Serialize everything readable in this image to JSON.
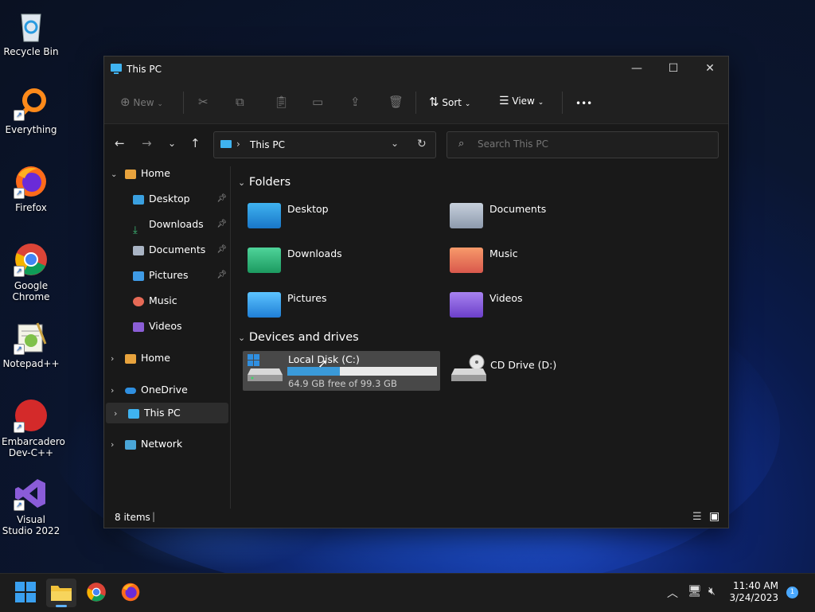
{
  "desktop": {
    "icons": [
      {
        "label": "Recycle Bin"
      },
      {
        "label": "Everything"
      },
      {
        "label": "Firefox"
      },
      {
        "label": "Google Chrome"
      },
      {
        "label": "Notepad++"
      },
      {
        "label": "Embarcadero Dev-C++"
      },
      {
        "label": "Visual Studio 2022"
      }
    ]
  },
  "window": {
    "title": "This PC",
    "controls": {
      "minimize": "—",
      "maximize": "☐",
      "close": "✕"
    },
    "toolbar": {
      "new_label": "New",
      "sort_label": "Sort",
      "view_label": "View",
      "more_label": "•••"
    },
    "address": {
      "path": "This PC"
    },
    "search": {
      "placeholder": "Search This PC"
    },
    "sidebar": {
      "home": "Home",
      "quick": [
        {
          "label": "Desktop",
          "pinned": true
        },
        {
          "label": "Downloads",
          "pinned": true
        },
        {
          "label": "Documents",
          "pinned": true
        },
        {
          "label": "Pictures",
          "pinned": true
        },
        {
          "label": "Music",
          "pinned": false
        },
        {
          "label": "Videos",
          "pinned": false
        }
      ],
      "roots": [
        {
          "label": "Home"
        },
        {
          "label": "OneDrive"
        },
        {
          "label": "This PC"
        },
        {
          "label": "Network"
        }
      ]
    },
    "content": {
      "folders_heading": "Folders",
      "folders": [
        {
          "label": "Desktop"
        },
        {
          "label": "Documents"
        },
        {
          "label": "Downloads"
        },
        {
          "label": "Music"
        },
        {
          "label": "Pictures"
        },
        {
          "label": "Videos"
        }
      ],
      "drives_heading": "Devices and drives",
      "drives": [
        {
          "label": "Local Disk (C:)",
          "free_text": "64.9 GB free of 99.3 GB",
          "used_fraction": 0.35
        },
        {
          "label": "CD Drive (D:)"
        }
      ]
    },
    "status": {
      "items": "8 items"
    }
  },
  "taskbar": {
    "time": "11:40 AM",
    "date": "3/24/2023",
    "notification_count": "1"
  }
}
